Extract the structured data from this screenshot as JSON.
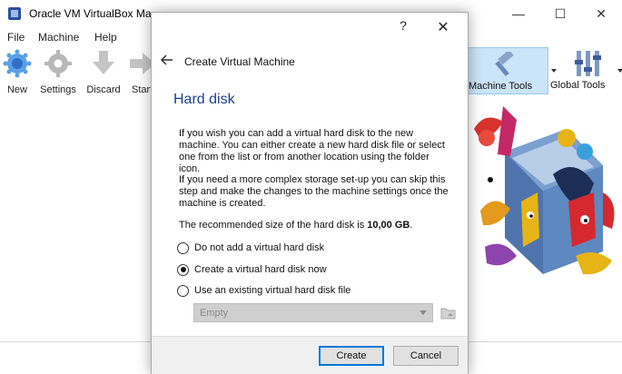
{
  "window": {
    "title": "Oracle VM VirtualBox Manager",
    "controls": {
      "minimize": "—",
      "maximize": "☐",
      "close": "✕"
    }
  },
  "menu": [
    "File",
    "Machine",
    "Help"
  ],
  "toolbar": {
    "new_label": "New",
    "settings_label": "Settings",
    "discard_label": "Discard",
    "start_label": "Start"
  },
  "right_tools": {
    "machine_tools_label": "Machine Tools",
    "global_tools_label": "Global Tools"
  },
  "dialog": {
    "help": "?",
    "close": "✕",
    "heading": "Create Virtual Machine",
    "page_title": "Hard disk",
    "para1": "If you wish you can add a virtual hard disk to the new machine. You can either create a new hard disk file or select one from the list or from another location using the folder icon.",
    "para2": "If you need a more complex storage set-up you can skip this step and make the changes to the machine settings once the machine is created.",
    "recommend_prefix": "The recommended size of the hard disk is ",
    "recommend_value": "10,00 GB",
    "recommend_suffix": ".",
    "options": [
      {
        "label": "Do not add a virtual hard disk",
        "checked": false
      },
      {
        "label": "Create a virtual hard disk now",
        "checked": true
      },
      {
        "label": "Use an existing virtual hard disk file",
        "checked": false
      }
    ],
    "file_select_value": "Empty",
    "create_label": "Create",
    "cancel_label": "Cancel"
  },
  "colors": {
    "accent": "#0078d7",
    "page_title": "#1a3f8e",
    "selected_tool_bg": "#cce4f7"
  }
}
